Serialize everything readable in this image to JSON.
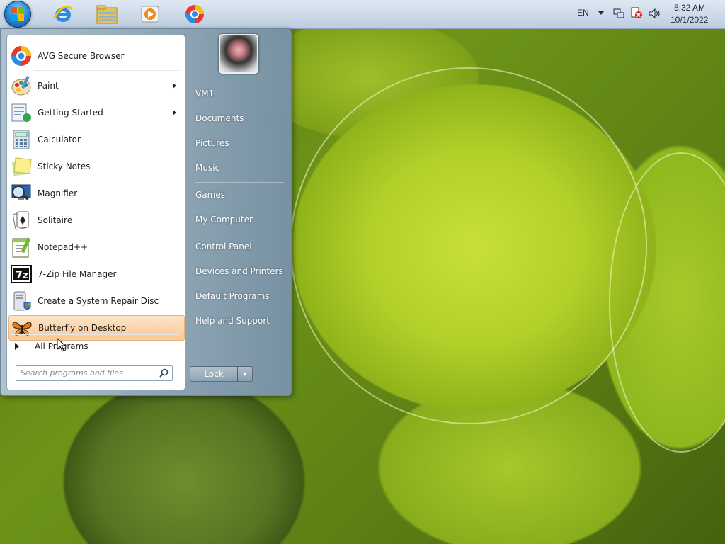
{
  "taskbar": {
    "apps": [
      {
        "name": "internet-explorer"
      },
      {
        "name": "file-explorer"
      },
      {
        "name": "media-player"
      },
      {
        "name": "avg-secure-browser"
      }
    ],
    "tray": {
      "language": "EN",
      "time": "5:32 AM",
      "date": "10/1/2022"
    }
  },
  "start_menu": {
    "programs": [
      {
        "label": "AVG Secure Browser",
        "icon": "avg-browser-icon",
        "submenu": false
      },
      {
        "label": "Paint",
        "icon": "paint-icon",
        "submenu": true
      },
      {
        "label": "Getting Started",
        "icon": "getting-started-icon",
        "submenu": true
      },
      {
        "label": "Calculator",
        "icon": "calculator-icon",
        "submenu": false
      },
      {
        "label": "Sticky Notes",
        "icon": "sticky-notes-icon",
        "submenu": false
      },
      {
        "label": "Magnifier",
        "icon": "magnifier-icon",
        "submenu": false
      },
      {
        "label": "Solitaire",
        "icon": "solitaire-icon",
        "submenu": false
      },
      {
        "label": "Notepad++",
        "icon": "notepadpp-icon",
        "submenu": false
      },
      {
        "label": "7-Zip File Manager",
        "icon": "7zip-icon",
        "submenu": false
      },
      {
        "label": "Create a System Repair Disc",
        "icon": "repair-disc-icon",
        "submenu": false
      },
      {
        "label": "Butterfly on Desktop",
        "icon": "butterfly-icon",
        "submenu": false,
        "highlighted": true
      }
    ],
    "all_programs": "All Programs",
    "search_placeholder": "Search programs and files",
    "places": [
      "VM1",
      "Documents",
      "Pictures",
      "Music",
      "Games",
      "My Computer",
      "Control Panel",
      "Devices and Printers",
      "Default Programs",
      "Help and Support"
    ],
    "lock_label": "Lock"
  }
}
